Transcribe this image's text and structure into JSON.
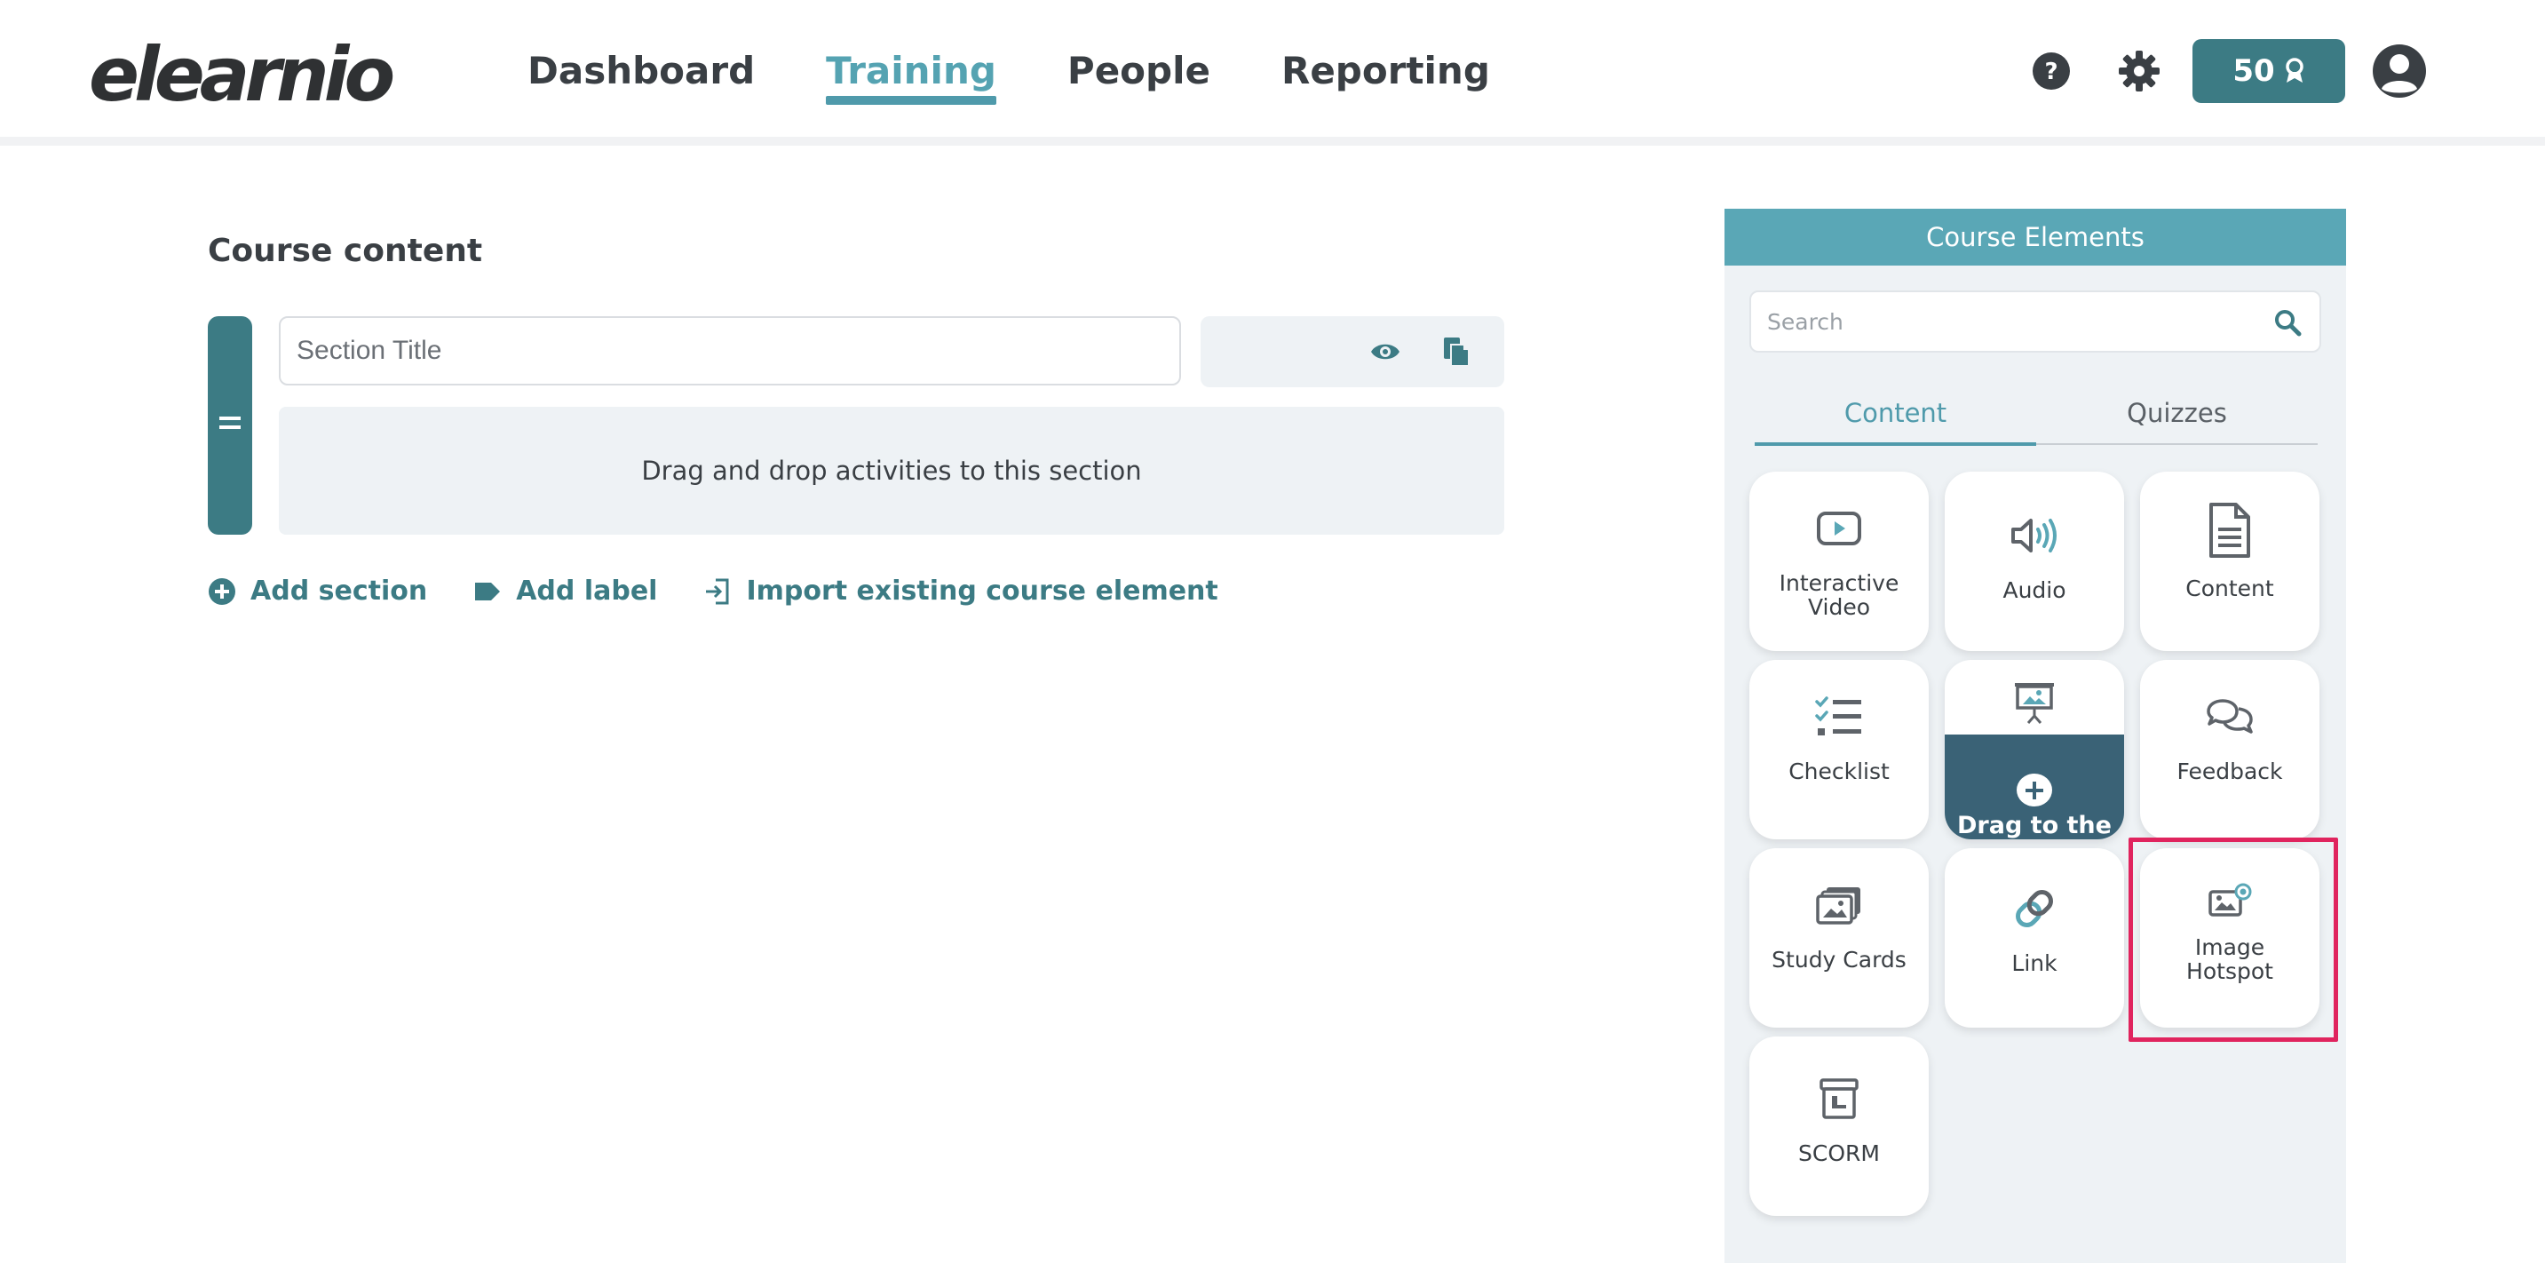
{
  "header": {
    "logo": "elearnio",
    "nav": [
      {
        "label": "Dashboard",
        "active": false
      },
      {
        "label": "Training",
        "active": true
      },
      {
        "label": "People",
        "active": false
      },
      {
        "label": "Reporting",
        "active": false
      }
    ],
    "points": "50",
    "icons": [
      "help-icon",
      "gear-icon",
      "award-icon",
      "avatar-icon"
    ]
  },
  "main": {
    "title": "Course content",
    "section": {
      "title_placeholder": "Section Title",
      "title_value": "",
      "dropzone_text": "Drag and drop activities to this section"
    },
    "actions": [
      {
        "label": "Add section",
        "icon": "plus-circle-icon"
      },
      {
        "label": "Add label",
        "icon": "tag-icon"
      },
      {
        "label": "Import existing course element",
        "icon": "import-icon"
      }
    ]
  },
  "panel": {
    "title": "Course Elements",
    "search_placeholder": "Search",
    "tabs": [
      {
        "label": "Content",
        "active": true
      },
      {
        "label": "Quizzes",
        "active": false
      }
    ],
    "elements": [
      {
        "label": "Interactive Video",
        "icon": "video-icon"
      },
      {
        "label": "Audio",
        "icon": "audio-icon"
      },
      {
        "label": "Content",
        "icon": "document-icon"
      },
      {
        "label": "Checklist",
        "icon": "checklist-icon"
      },
      {
        "label": "",
        "icon": "presentation-icon",
        "drag_overlay_text": "Drag to the"
      },
      {
        "label": "Feedback",
        "icon": "feedback-icon"
      },
      {
        "label": "Study Cards",
        "icon": "study-cards-icon"
      },
      {
        "label": "Link",
        "icon": "link-icon"
      },
      {
        "label": "Image Hotspot",
        "icon": "image-hotspot-icon"
      },
      {
        "label": "SCORM",
        "icon": "scorm-icon"
      }
    ],
    "accent_color": "#5aa7b6",
    "highlight_color": "#e0245e"
  }
}
